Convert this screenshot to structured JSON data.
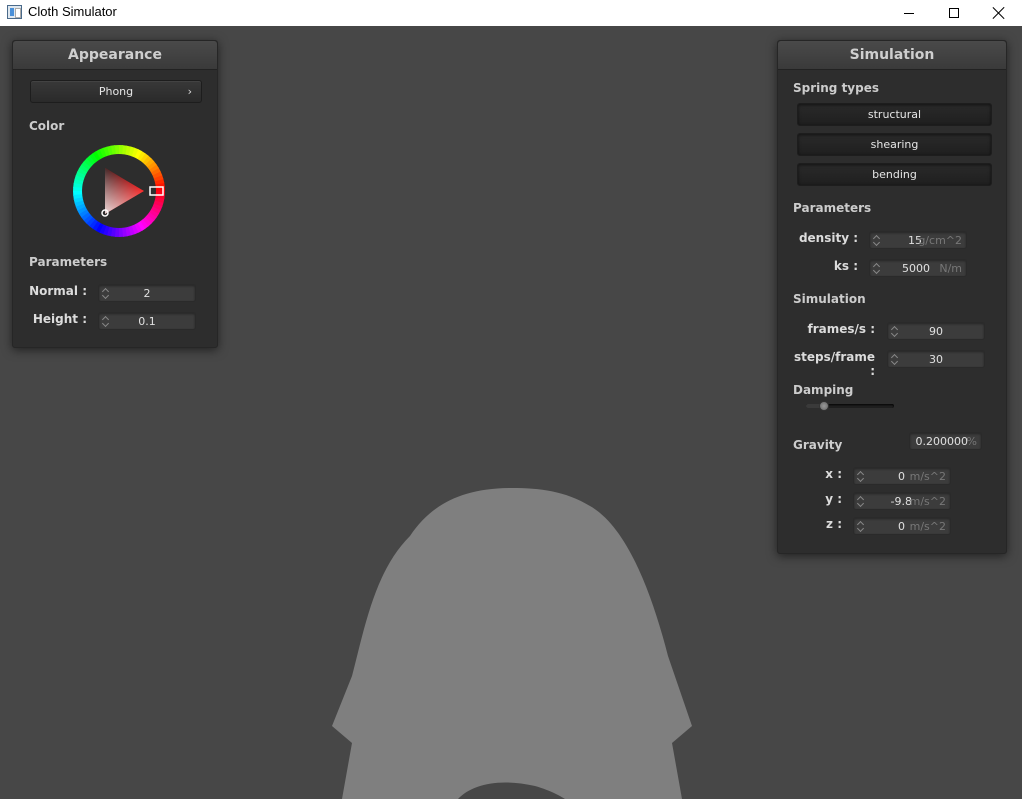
{
  "window": {
    "title": "Cloth Simulator"
  },
  "appearance": {
    "title": "Appearance",
    "shader_label": "Phong",
    "color_label": "Color",
    "selected_color": "#ff0000",
    "parameters_label": "Parameters",
    "normal": {
      "label": "Normal :",
      "value": "2"
    },
    "height": {
      "label": "Height :",
      "value": "0.1"
    }
  },
  "simulation": {
    "title": "Simulation",
    "spring_types_label": "Spring types",
    "spring_buttons": [
      "structural",
      "shearing",
      "bending"
    ],
    "parameters_label": "Parameters",
    "density": {
      "label": "density :",
      "value": "15",
      "unit": "g/cm^2"
    },
    "ks": {
      "label": "ks :",
      "value": "5000",
      "unit": "N/m"
    },
    "sim_label": "Simulation",
    "frames": {
      "label": "frames/s :",
      "value": "90"
    },
    "steps": {
      "label": "steps/frame :",
      "value": "30"
    },
    "damping_label": "Damping",
    "damping": {
      "value": "0.200000",
      "unit": "%",
      "slider_fraction": 0.2
    },
    "gravity_label": "Gravity",
    "gx": {
      "label": "x :",
      "value": "0",
      "unit": "m/s^2"
    },
    "gy": {
      "label": "y :",
      "value": "-9.8",
      "unit": "m/s^2"
    },
    "gz": {
      "label": "z :",
      "value": "0",
      "unit": "m/s^2"
    }
  },
  "colors": {
    "background": "#474747",
    "cloth": "#7f7f7f",
    "panel": "#2d2d2d"
  }
}
